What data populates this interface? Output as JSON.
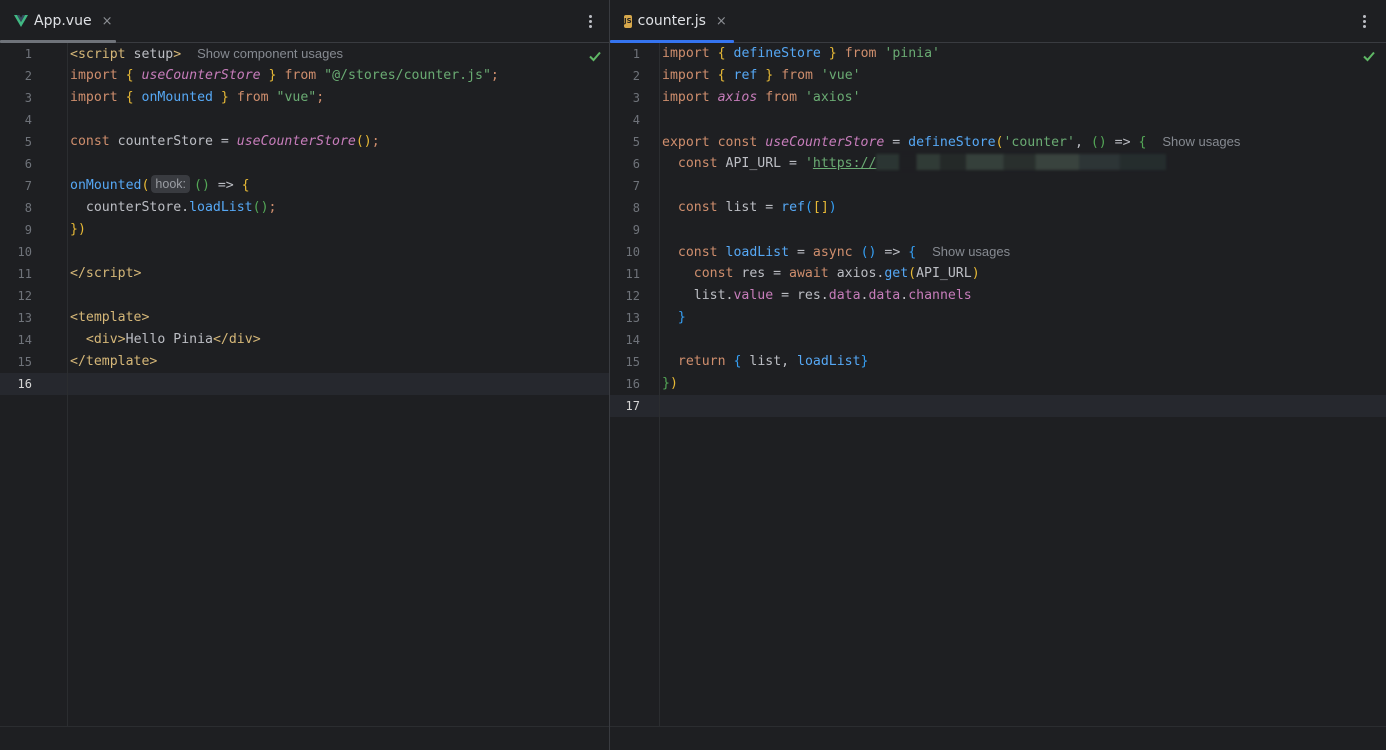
{
  "left_pane": {
    "tab": {
      "name": "App.vue",
      "close": "×",
      "icon": "vue-icon"
    },
    "more": "more-actions-icon",
    "current_line": 16,
    "line_numbers": [
      "1",
      "2",
      "3",
      "4",
      "5",
      "6",
      "7",
      "8",
      "9",
      "10",
      "11",
      "12",
      "13",
      "14",
      "15",
      "16"
    ],
    "code": {
      "l1": {
        "open": "<",
        "tag": "script",
        "attr": " setup",
        "close": ">",
        "hint": "Show component usages"
      },
      "l2": {
        "kw": "import",
        "b_open": "{",
        "name": "useCounterStore",
        "b_close": "}",
        "from": "from",
        "path": "\"@/stores/counter.js\"",
        "semi": ";"
      },
      "l3": {
        "kw": "import",
        "b_open": "{",
        "name": "onMounted",
        "b_close": "}",
        "from": "from",
        "path": "\"vue\"",
        "semi": ";"
      },
      "l5": {
        "kw": "const",
        "var": " counterStore ",
        "eq": "= ",
        "call": "useCounterStore",
        "parens": "()",
        "semi": ";"
      },
      "l7": {
        "fn": "onMounted",
        "open": "(",
        "param_hint": "hook:",
        "arrow_parens": "()",
        "arrow": " => ",
        "brace": "{"
      },
      "l8": {
        "obj": "counterStore.",
        "method": "loadList",
        "parens": "()",
        "semi": ";"
      },
      "l9": {
        "brace": "}",
        "close": ")"
      },
      "l11": {
        "open": "</",
        "tag": "script",
        "close": ">"
      },
      "l13": {
        "open": "<",
        "tag": "template",
        "close": ">"
      },
      "l14": {
        "open": "<",
        "tag": "div",
        "close": ">",
        "text": "Hello Pinia",
        "end_open": "</",
        "end_tag": "div",
        "end_close": ">"
      },
      "l15": {
        "open": "</",
        "tag": "template",
        "close": ">"
      }
    }
  },
  "right_pane": {
    "tab": {
      "name": "counter.js",
      "close": "×",
      "icon": "javascript-file-icon",
      "icon_text": "JS"
    },
    "more": "more-actions-icon",
    "current_line": 17,
    "line_numbers": [
      "1",
      "2",
      "3",
      "4",
      "5",
      "6",
      "7",
      "8",
      "9",
      "10",
      "11",
      "12",
      "13",
      "14",
      "15",
      "16",
      "17"
    ],
    "code": {
      "l1": {
        "kw": "import",
        "b_open": "{",
        "name": "defineStore",
        "b_close": "}",
        "from": "from",
        "path": "'pinia'"
      },
      "l2": {
        "kw": "import",
        "b_open": "{",
        "name": "ref",
        "b_close": "}",
        "from": "from",
        "path": "'vue'"
      },
      "l3": {
        "kw": "import",
        "name": "axios",
        "from": "from",
        "path": "'axios'"
      },
      "l5": {
        "kw1": "export",
        "kw2": "const",
        "name": "useCounterStore",
        "eq": " = ",
        "call": "defineStore",
        "open": "(",
        "id": "'counter'",
        "comma": ", ",
        "arrow_parens": "()",
        "arrow": " => ",
        "brace": "{",
        "hint": "Show usages"
      },
      "l6": {
        "kw": "const",
        "var": " API_URL = ",
        "quote": "'",
        "url": "https://"
      },
      "l8": {
        "kw": "const",
        "var": " list = ",
        "call": "ref",
        "open": "(",
        "arr": "[]",
        "close": ")"
      },
      "l10": {
        "kw": "const",
        "name": "loadList",
        "eq": " = ",
        "async": "async",
        "arrow_parens": "()",
        "arrow": " => ",
        "brace": "{",
        "hint": "Show usages"
      },
      "l11": {
        "kw": "const",
        "var": " res = ",
        "await": "await",
        "obj": " axios.",
        "method": "get",
        "open": "(",
        "arg": "API_URL",
        "close": ")"
      },
      "l12": {
        "obj": "list.",
        "prop": "value",
        "eq": " = res.",
        "p1": "data",
        "dot1": ".",
        "p2": "data",
        "dot2": ".",
        "p3": "channels"
      },
      "l13": {
        "brace": "}"
      },
      "l15": {
        "kw": "return",
        "open": "{",
        "a": " list, ",
        "b": "loadList",
        "close": "}"
      },
      "l16": {
        "brace": "}",
        "close": ")"
      }
    }
  },
  "colors": {
    "background": "#1e1f22",
    "keyword": "#cf8e6d",
    "string": "#6aab73",
    "function": "#56a8f5",
    "italic_function": "#c77dbb",
    "tag": "#d5b778",
    "active_tab_underline": "#3574f0",
    "inactive_tab_underline": "#6f737a",
    "check": "#5fb865"
  }
}
